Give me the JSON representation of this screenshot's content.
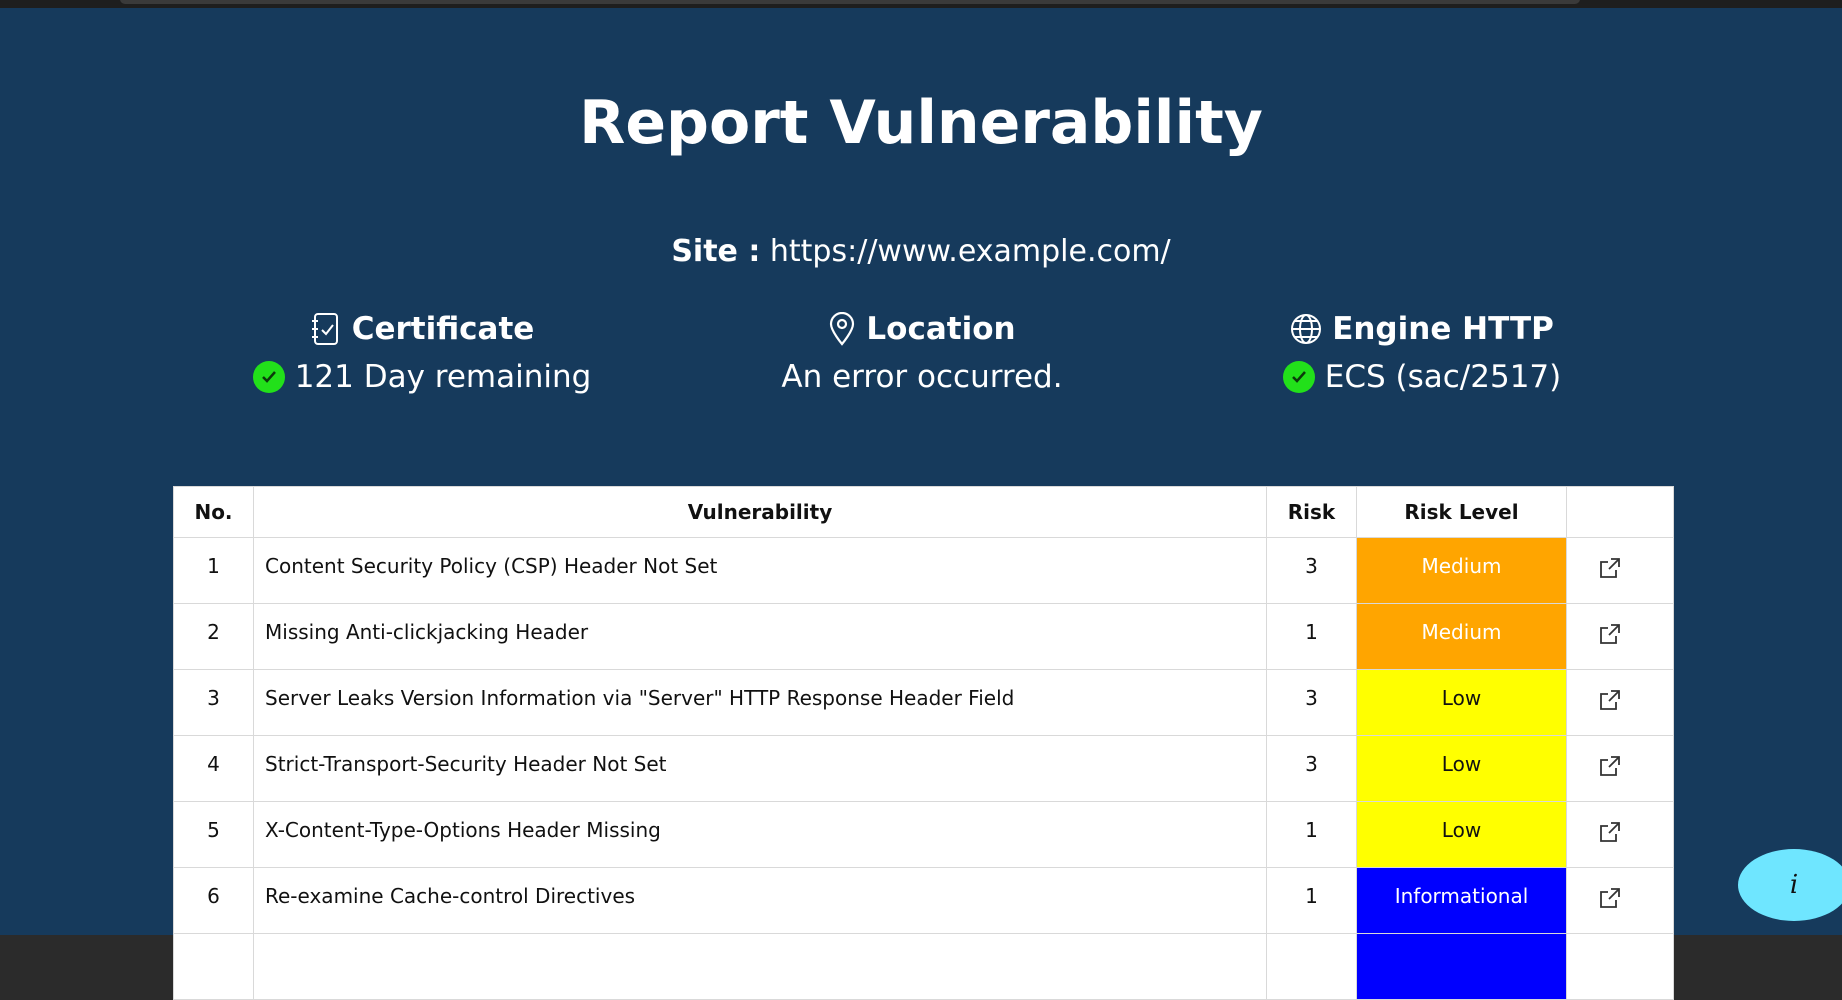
{
  "page": {
    "title": "Report Vulnerability",
    "site_label": "Site :",
    "site_url": "https://www.example.com/"
  },
  "info": {
    "certificate": {
      "label": "Certificate",
      "value": "121 Day remaining",
      "icon": "certificate-icon",
      "status": "ok"
    },
    "location": {
      "label": "Location",
      "value": "An error occurred.",
      "icon": "map-pin-icon"
    },
    "engine": {
      "label": "Engine HTTP",
      "value": "ECS (sac/2517)",
      "icon": "globe-icon",
      "status": "ok"
    }
  },
  "table": {
    "headers": [
      "No.",
      "Vulnerability",
      "Risk",
      "Risk Level",
      ""
    ],
    "rows": [
      {
        "no": "1",
        "vulnerability": "Content Security Policy (CSP) Header Not Set",
        "risk": "3",
        "level": "Medium",
        "level_color": "#ffa500",
        "level_text_color": "#ffffff"
      },
      {
        "no": "2",
        "vulnerability": "Missing Anti-clickjacking Header",
        "risk": "1",
        "level": "Medium",
        "level_color": "#ffa500",
        "level_text_color": "#ffffff"
      },
      {
        "no": "3",
        "vulnerability": "Server Leaks Version Information via \"Server\" HTTP Response Header Field",
        "risk": "3",
        "level": "Low",
        "level_color": "#ffff00",
        "level_text_color": "#111111"
      },
      {
        "no": "4",
        "vulnerability": "Strict-Transport-Security Header Not Set",
        "risk": "3",
        "level": "Low",
        "level_color": "#ffff00",
        "level_text_color": "#111111"
      },
      {
        "no": "5",
        "vulnerability": "X-Content-Type-Options Header Missing",
        "risk": "1",
        "level": "Low",
        "level_color": "#ffff00",
        "level_text_color": "#111111"
      },
      {
        "no": "6",
        "vulnerability": "Re-examine Cache-control Directives",
        "risk": "1",
        "level": "Informational",
        "level_color": "#0000ff",
        "level_text_color": "#ffffff"
      }
    ]
  },
  "fab": {
    "label": "i",
    "icon": "info-icon"
  },
  "colors": {
    "background": "#163a5c",
    "ok": "#22e01a",
    "fab": "#6fe6ff"
  }
}
